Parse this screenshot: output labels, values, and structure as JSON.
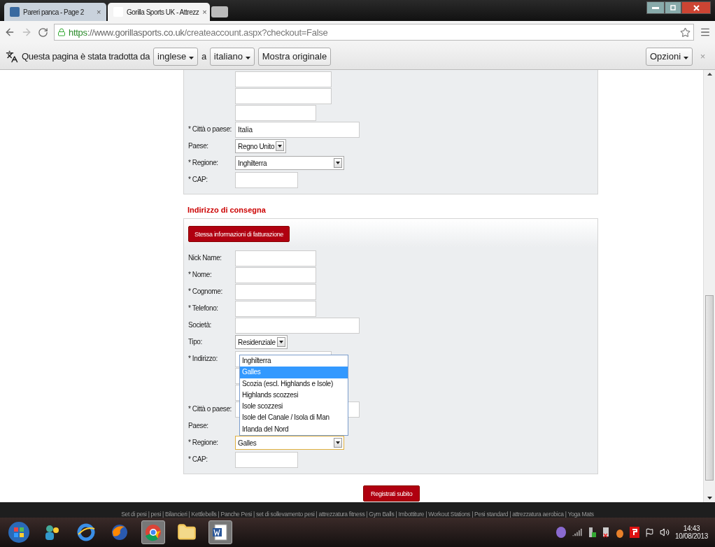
{
  "browser": {
    "tabs": [
      {
        "title": "Pareri panca - Page 2",
        "selected": false,
        "close": "×"
      },
      {
        "title": "Gorilla Sports UK - Attrezz",
        "selected": true,
        "close": "×"
      }
    ],
    "url": {
      "scheme": "https",
      "separator": "://",
      "host": "www.gorillasports.co.uk",
      "path": "/createaccount.aspx?checkout=False"
    },
    "translate_bar": {
      "message": "Questa pagina è stata tradotta da",
      "from": "inglese",
      "joiner": "a",
      "to": "italiano",
      "show_original": "Mostra originale",
      "options": "Opzioni",
      "close": "×"
    }
  },
  "billing": {
    "fields": [
      {
        "kind": "address"
      },
      {
        "kind": "input",
        "label": "* Città o paese:",
        "value": "Italia"
      },
      {
        "kind": "select",
        "label": "Paese:",
        "value": "Regno Unito"
      },
      {
        "kind": "select",
        "label": "* Regione:",
        "value": "Inghilterra"
      },
      {
        "kind": "input",
        "label": "* CAP:"
      }
    ]
  },
  "delivery": {
    "heading": "Indirizzo di consegna",
    "copy_button": "Stessa informazioni di fatturazione",
    "fields": [
      {
        "kind": "input",
        "label": "Nick Name:"
      },
      {
        "kind": "input",
        "label": "* Nome:"
      },
      {
        "kind": "input",
        "label": "* Cognome:"
      },
      {
        "kind": "input",
        "label": "* Telefono:"
      },
      {
        "kind": "input",
        "label": "Società:"
      },
      {
        "kind": "select",
        "label": "Tipo:",
        "value": "Residenziale"
      },
      {
        "kind": "address",
        "label": "* Indirizzo:"
      },
      {
        "kind": "input",
        "label": "* Città o paese:"
      },
      {
        "kind": "covered",
        "label": "Paese:"
      },
      {
        "kind": "select",
        "label": "* Regione:",
        "value": "Galles",
        "focused": true
      },
      {
        "kind": "input",
        "label": "* CAP:"
      }
    ],
    "dropdown": [
      {
        "label": "Inghilterra",
        "selected": false
      },
      {
        "label": "Galles",
        "selected": true
      },
      {
        "label": "Scozia (escl. Highlands e Isole)",
        "selected": false
      },
      {
        "label": "Highlands scozzesi",
        "selected": false
      },
      {
        "label": "Isole scozzesi",
        "selected": false
      },
      {
        "label": "Isole del Canale / Isola di Man",
        "selected": false
      },
      {
        "label": "Irlanda del Nord",
        "selected": false
      }
    ]
  },
  "submit": "Registrati subito",
  "footer_links": "Set di pesi | pesi | Bilancieri | Kettlebells | Panche Pesi | set di sollevamento pesi | attrezzatura fitness | Gym Balls | Imbottiture | Workout Stations | Pesi standard | attrezzatura aerobica | Yoga Mats",
  "taskbar": {
    "time": "14:43",
    "date": "10/08/2013"
  }
}
